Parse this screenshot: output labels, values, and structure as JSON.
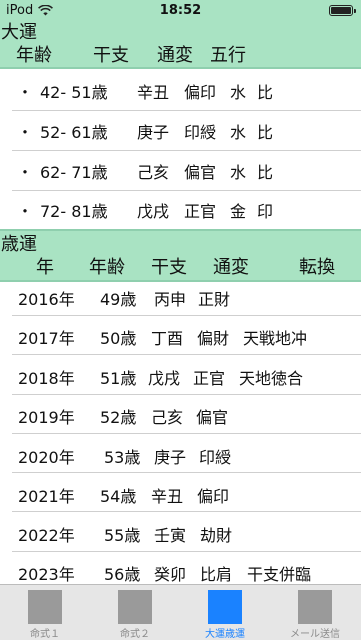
{
  "status": {
    "carrier": "iPod",
    "time": "18:52"
  },
  "daiun": {
    "title": "大運",
    "headers": {
      "age": "年齢",
      "kanshi": "干支",
      "tsuhen": "通変",
      "gogyo": "五行"
    },
    "rows": [
      {
        "bullet": "・",
        "age": "42- 51歳",
        "kanshi": "辛丑",
        "tsuhen": "偏印",
        "element": "水",
        "relation": "比"
      },
      {
        "bullet": "・",
        "age": "52- 61歳",
        "kanshi": "庚子",
        "tsuhen": "印綬",
        "element": "水",
        "relation": "比"
      },
      {
        "bullet": "・",
        "age": "62- 71歳",
        "kanshi": "己亥",
        "tsuhen": "偏官",
        "element": "水",
        "relation": "比"
      },
      {
        "bullet": "・",
        "age": "72- 81歳",
        "kanshi": "戊戌",
        "tsuhen": "正官",
        "element": "金",
        "relation": "印"
      }
    ]
  },
  "saiun": {
    "title": "歳運",
    "headers": {
      "year": "年",
      "age": "年齢",
      "kanshi": "干支",
      "tsuhen": "通変",
      "tenkan": "転換"
    },
    "rows": [
      {
        "year": "2016年",
        "age": "49歳",
        "kanshi": "丙申",
        "tsuhen": "正財",
        "note": ""
      },
      {
        "year": "2017年",
        "age": "50歳",
        "kanshi": "丁酉",
        "tsuhen": "偏財",
        "note": "天戦地冲"
      },
      {
        "year": "2018年",
        "age": "51歳",
        "kanshi": "戊戌",
        "tsuhen": "正官",
        "note": "天地徳合"
      },
      {
        "year": "2019年",
        "age": "52歳",
        "kanshi": "己亥",
        "tsuhen": "偏官",
        "note": ""
      },
      {
        "year": "2020年",
        "age": "53歳",
        "kanshi": "庚子",
        "tsuhen": "印綬",
        "note": ""
      },
      {
        "year": "2021年",
        "age": "54歳",
        "kanshi": "辛丑",
        "tsuhen": "偏印",
        "note": ""
      },
      {
        "year": "2022年",
        "age": "55歳",
        "kanshi": "壬寅",
        "tsuhen": "劫財",
        "note": ""
      },
      {
        "year": "2023年",
        "age": "56歳",
        "kanshi": "癸卯",
        "tsuhen": "比肩",
        "note": "干支併臨"
      }
    ]
  },
  "tabs": [
    {
      "label": "命式１",
      "active": false
    },
    {
      "label": "命式２",
      "active": false
    },
    {
      "label": "大運歳運",
      "active": true
    },
    {
      "label": "メール送信",
      "active": false
    }
  ],
  "colors": {
    "header_bg": "#a9e3c3",
    "active_tab": "#1a82ff",
    "tab_bg": "#e6e6e6"
  }
}
